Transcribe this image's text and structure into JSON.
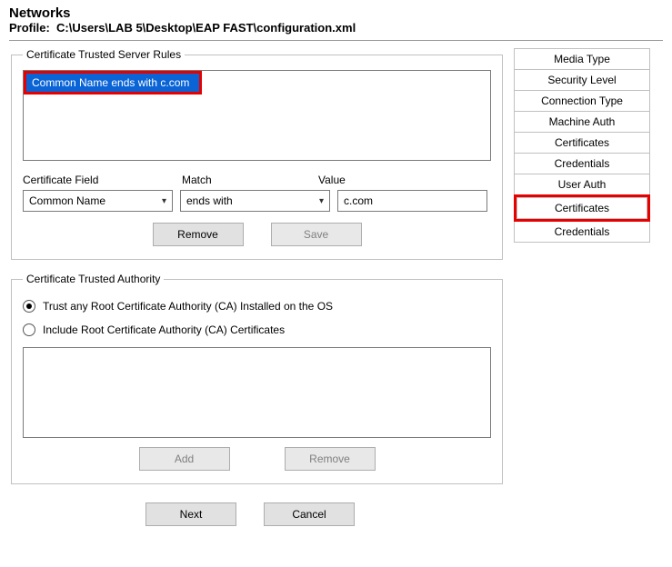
{
  "header": {
    "title": "Networks",
    "profile_label": "Profile:",
    "profile_path": "C:\\Users\\LAB 5\\Desktop\\EAP FAST\\configuration.xml"
  },
  "rules": {
    "legend": "Certificate Trusted Server Rules",
    "items": [
      "Common Name ends with c.com"
    ],
    "field_label": "Certificate Field",
    "match_label": "Match",
    "value_label": "Value",
    "field_value": "Common Name",
    "match_value": "ends with",
    "value_value": "c.com",
    "remove_btn": "Remove",
    "save_btn": "Save"
  },
  "authority": {
    "legend": "Certificate Trusted Authority",
    "radio_trust_any": "Trust any Root Certificate Authority (CA) Installed on the OS",
    "radio_include": "Include Root Certificate Authority (CA) Certificates",
    "selected": "trust_any",
    "add_btn": "Add",
    "remove_btn": "Remove"
  },
  "footer": {
    "next_btn": "Next",
    "cancel_btn": "Cancel"
  },
  "sidebar": {
    "items": [
      "Media Type",
      "Security Level",
      "Connection Type",
      "Machine Auth",
      "Certificates",
      "Credentials",
      "User Auth",
      "Certificates",
      "Credentials"
    ],
    "highlighted_index": 7
  }
}
